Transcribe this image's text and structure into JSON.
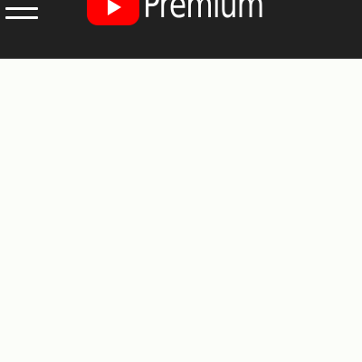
{
  "header": {
    "brand_text": "Premium"
  },
  "colors": {
    "header_background": "#212121",
    "logo_red": "#ff0000",
    "content_background": "#fbfdf9"
  },
  "icons": {
    "menu": "hamburger-menu-icon",
    "logo": "youtube-play-icon"
  }
}
